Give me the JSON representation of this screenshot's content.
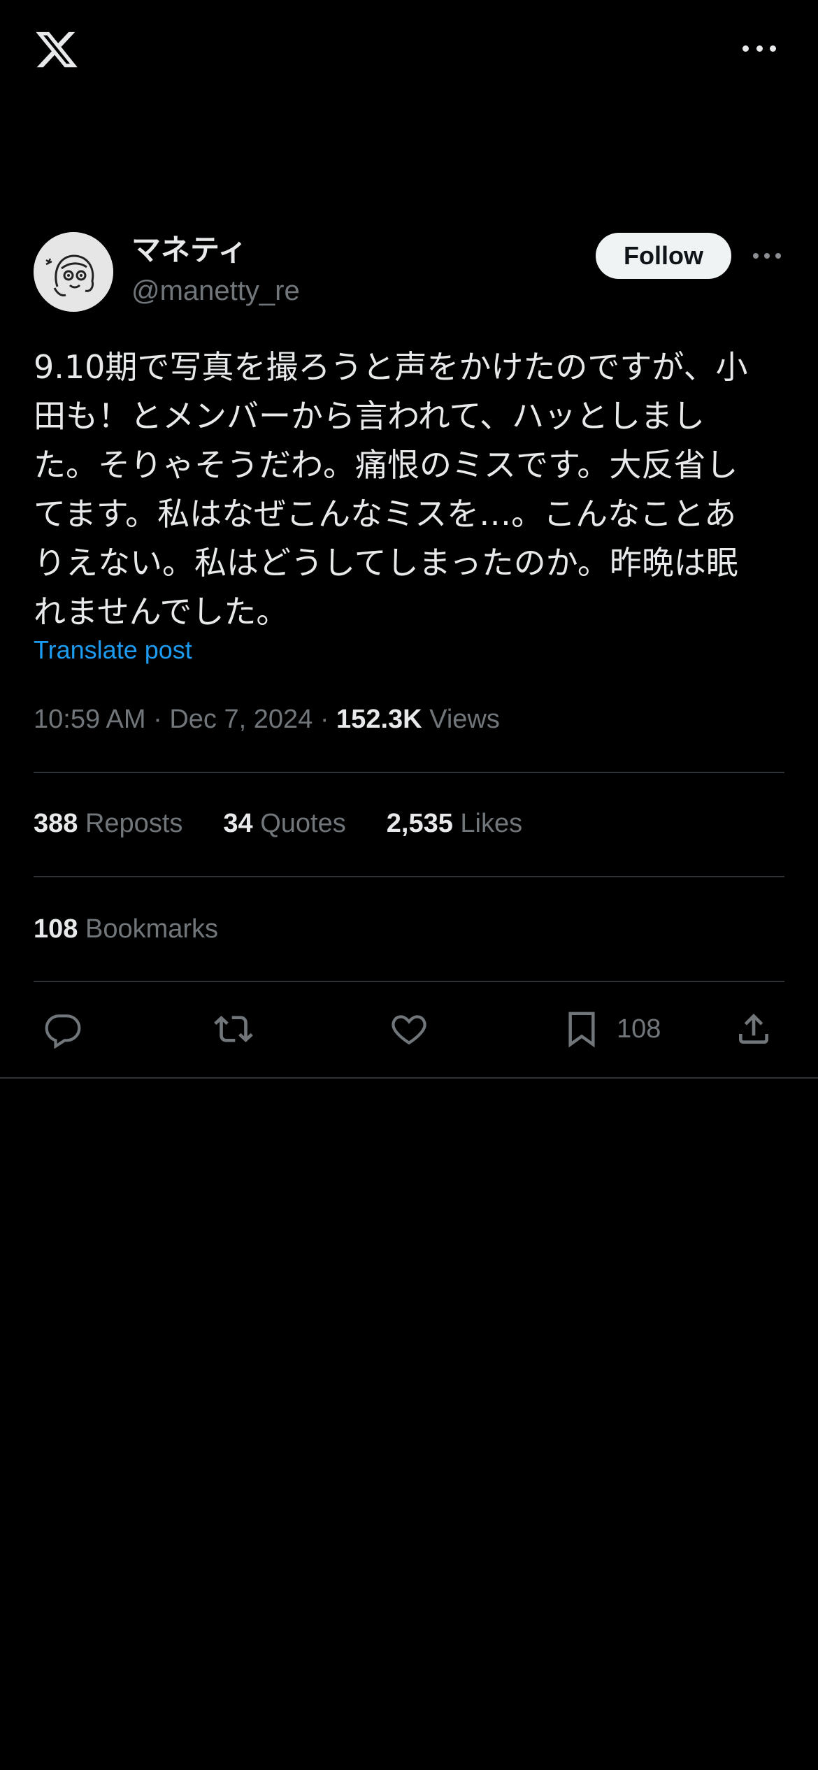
{
  "header": {
    "logo_icon": "x-logo-icon",
    "more_icon": "more-horizontal-icon"
  },
  "author": {
    "display_name": "マネティ",
    "handle": "@manetty_re",
    "follow_label": "Follow",
    "avatar_icon": "avatar-drawing-icon"
  },
  "post": {
    "text_lines": [
      "9.10期で写真を撮ろうと声をかけたのですが、小",
      "田も！とメンバーから言われて、ハッとしまし",
      "た。そりゃそうだわ。痛恨のミスです。大反省し",
      "てます。私はなぜこんなミスを…。こんなことあ",
      "りえない。私はどうしてしまったのか。昨晩は眠",
      "れませんでした。"
    ],
    "translate_label": "Translate post",
    "time": "10:59 AM",
    "date": "Dec 7, 2024",
    "separator": "·",
    "views_count": "152.3K",
    "views_label": "Views"
  },
  "stats": {
    "reposts": {
      "count": "388",
      "label": "Reposts"
    },
    "quotes": {
      "count": "34",
      "label": "Quotes"
    },
    "likes": {
      "count": "2,535",
      "label": "Likes"
    },
    "bookmarks": {
      "count": "108",
      "label": "Bookmarks"
    }
  },
  "actions": {
    "reply_icon": "reply-icon",
    "repost_icon": "repost-icon",
    "like_icon": "like-icon",
    "bookmark_icon": "bookmark-icon",
    "bookmark_count": "108",
    "share_icon": "share-icon"
  },
  "colors": {
    "background": "#000000",
    "text_primary": "#e7e9ea",
    "text_secondary": "#71767b",
    "link": "#1d9bf0",
    "divider": "#2f3336",
    "follow_bg": "#eff3f4"
  }
}
